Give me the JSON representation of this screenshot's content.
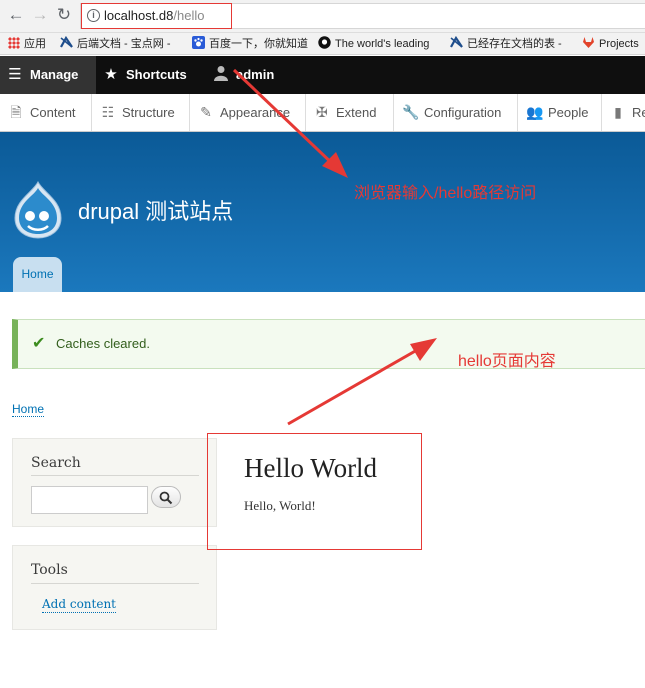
{
  "browser": {
    "url_host": "localhost.d8",
    "url_path": "/hello",
    "bookmarks": [
      {
        "label": "应用",
        "icon": "apps-grid-icon"
      },
      {
        "label": "后端文档 - 宝点网 - ",
        "icon": "confluence-icon"
      },
      {
        "label": "百度一下，你就知道",
        "icon": "baidu-paw-icon"
      },
      {
        "label": "The world's leading",
        "icon": "github-icon"
      },
      {
        "label": "已经存在文档的表 - ",
        "icon": "confluence-icon"
      },
      {
        "label": "Projects",
        "icon": "gitlab-icon"
      }
    ]
  },
  "toolbar": {
    "manage": "Manage",
    "shortcuts": "Shortcuts",
    "admin": "admin"
  },
  "tray": {
    "items": [
      "Content",
      "Structure",
      "Appearance",
      "Extend",
      "Configuration",
      "People",
      "Re"
    ]
  },
  "header": {
    "site_name": "drupal 测试站点",
    "home_tab": "Home"
  },
  "message": {
    "text": "Caches cleared."
  },
  "breadcrumb": {
    "home": "Home"
  },
  "sidebar": {
    "search_title": "Search",
    "tools_title": "Tools",
    "tools_link": "Add content"
  },
  "content": {
    "title": "Hello World",
    "body": "Hello, World!"
  },
  "annotations": {
    "url_note": "浏览器输入/hello路径访问",
    "content_note": "hello页面内容"
  },
  "colors": {
    "annotation": "#e53935",
    "link": "#0071b3",
    "header_top": "#0b5a97",
    "header_bottom": "#1b78bd"
  }
}
